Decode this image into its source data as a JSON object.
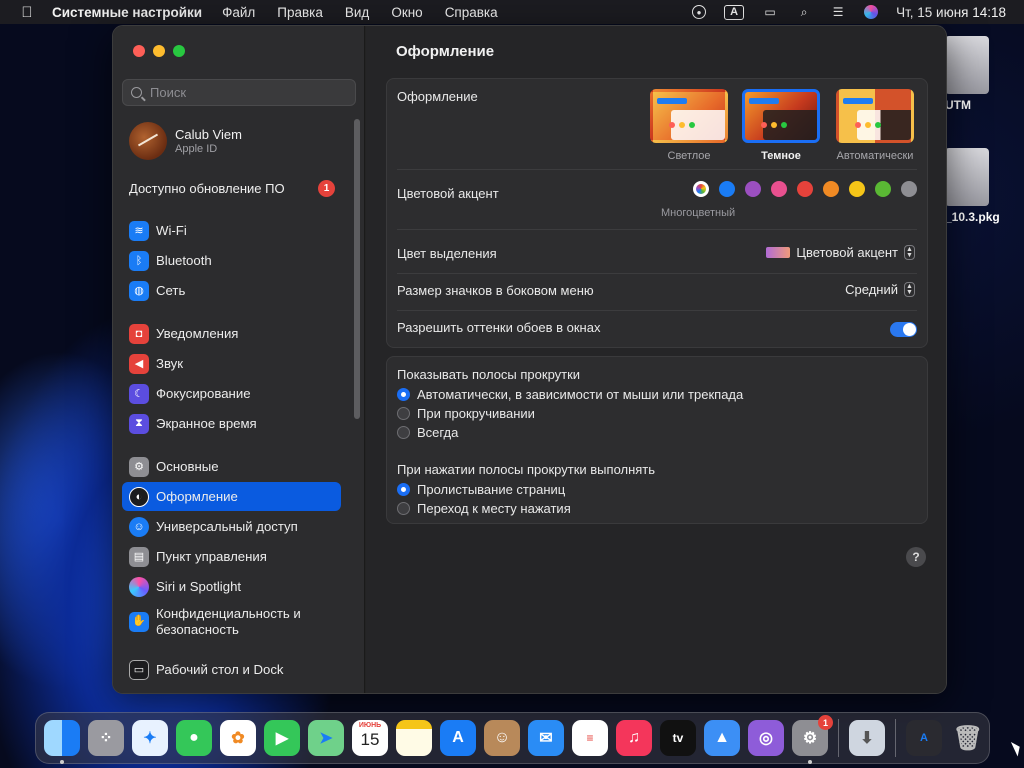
{
  "menubar": {
    "app_name": "Системные настройки",
    "items": [
      "Файл",
      "Правка",
      "Вид",
      "Окно",
      "Справка"
    ],
    "input_source": "A",
    "datetime": "Чт, 15 июня  14:18"
  },
  "desktop": {
    "icons": [
      {
        "label": "UTM"
      },
      {
        "label": "_10.3.pkg"
      }
    ]
  },
  "sidebar": {
    "search_placeholder": "Поиск",
    "account": {
      "name": "Calub Viem",
      "subtitle": "Apple ID"
    },
    "update": {
      "label": "Доступно обновление ПО",
      "badge": "1"
    },
    "items": [
      {
        "label": "Wi-Fi",
        "icon": "wifi-icon",
        "color": "#1a7cf5"
      },
      {
        "label": "Bluetooth",
        "icon": "bluetooth-icon",
        "color": "#1a7cf5"
      },
      {
        "label": "Сеть",
        "icon": "globe-icon",
        "color": "#1a7cf5"
      },
      {
        "label": "Уведомления",
        "icon": "bell-icon",
        "color": "#e5423b"
      },
      {
        "label": "Звук",
        "icon": "speaker-icon",
        "color": "#e5423b"
      },
      {
        "label": "Фокусирование",
        "icon": "moon-icon",
        "color": "#5b4de0"
      },
      {
        "label": "Экранное время",
        "icon": "hourglass-icon",
        "color": "#5b4de0"
      },
      {
        "label": "Основные",
        "icon": "gear-icon",
        "color": "#8e8e93"
      },
      {
        "label": "Оформление",
        "icon": "appearance-icon",
        "color": "#1c1c1e"
      },
      {
        "label": "Универсальный доступ",
        "icon": "accessibility-icon",
        "color": "#1a7cf5"
      },
      {
        "label": "Пункт управления",
        "icon": "control-center-icon",
        "color": "#8e8e93"
      },
      {
        "label": "Siri и Spotlight",
        "icon": "siri-icon",
        "color": "#a040d0"
      },
      {
        "label": "Конфиденциальность и безопасность",
        "icon": "hand-icon",
        "color": "#1a7cf5"
      },
      {
        "label": "Рабочий стол и Dock",
        "icon": "dock-icon",
        "color": "#1c1c1e"
      }
    ],
    "active_index": 8
  },
  "content": {
    "title": "Оформление",
    "appearance": {
      "label": "Оформление",
      "options": [
        {
          "label": "Светлое",
          "selected": false
        },
        {
          "label": "Темное",
          "selected": true
        },
        {
          "label": "Автоматически",
          "selected": false
        }
      ]
    },
    "accent": {
      "label": "Цветовой акцент",
      "selected_name": "Многоцветный",
      "colors": [
        "multicolor",
        "#1a7cf5",
        "#9b4fc0",
        "#e8508f",
        "#e5423b",
        "#f08a24",
        "#f5c518",
        "#5ab834",
        "#8e8e93"
      ]
    },
    "highlight": {
      "label": "Цвет выделения",
      "value": "Цветовой акцент"
    },
    "icon_size": {
      "label": "Размер значков в боковом меню",
      "value": "Средний"
    },
    "wallpaper_tint": {
      "label": "Разрешить оттенки обоев в окнах",
      "enabled": true
    },
    "scrollbars": {
      "label": "Показывать полосы прокрутки",
      "options": [
        {
          "label": "Автоматически, в зависимости от мыши или трекпада",
          "selected": true
        },
        {
          "label": "При прокручивании",
          "selected": false
        },
        {
          "label": "Всегда",
          "selected": false
        }
      ]
    },
    "click_scrollbar": {
      "label": "При нажатии полосы прокрутки выполнять",
      "options": [
        {
          "label": "Пролистывание страниц",
          "selected": true
        },
        {
          "label": "Переход к месту нажатия",
          "selected": false
        }
      ]
    },
    "help": "?"
  },
  "dock": {
    "calendar_month": "ИЮНЬ",
    "calendar_day": "15",
    "tv_label": "tv",
    "settings_badge": "1"
  }
}
